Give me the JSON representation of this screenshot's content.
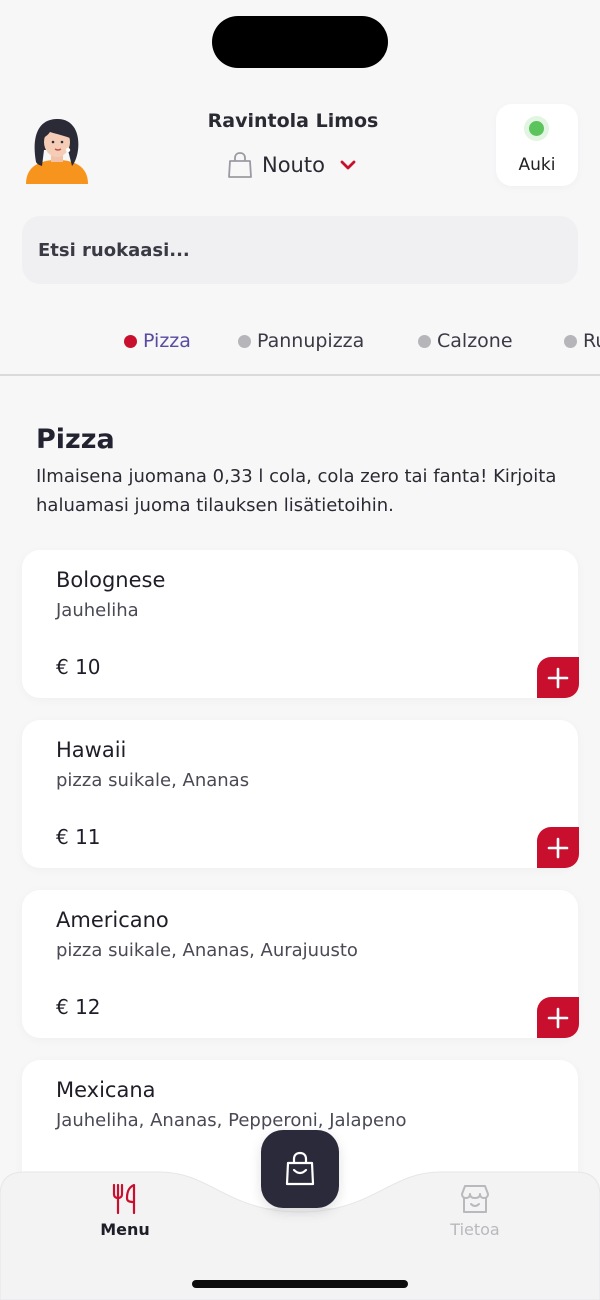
{
  "header": {
    "store_name": "Ravintola Limos",
    "mode_label": "Nouto",
    "status_label": "Auki"
  },
  "search": {
    "placeholder": "Etsi ruokaasi..."
  },
  "tabs": [
    {
      "label": "Pizza",
      "active": true
    },
    {
      "label": "Pannupizza",
      "active": false
    },
    {
      "label": "Calzone",
      "active": false
    },
    {
      "label": "Ru",
      "active": false
    }
  ],
  "section": {
    "title": "Pizza",
    "description": "Ilmaisena juomana 0,33 l cola, cola zero tai fanta! Kirjoita haluamasi juoma tilauksen lisätietoihin."
  },
  "items": [
    {
      "name": "Bolognese",
      "description": "Jauheliha",
      "price": "€ 10"
    },
    {
      "name": "Hawaii",
      "description": "pizza suikale, Ananas",
      "price": "€ 11"
    },
    {
      "name": "Americano",
      "description": "pizza suikale, Ananas, Aurajuusto",
      "price": "€ 12"
    },
    {
      "name": "Mexicana",
      "description": "Jauheliha, Ananas, Pepperoni, Jalapeno",
      "price": ""
    }
  ],
  "bottom_nav": {
    "menu_label": "Menu",
    "info_label": "Tietoa"
  },
  "colors": {
    "accent": "#c8102e",
    "open_status": "#5cc45c",
    "active_tab_text": "#5a4aa0",
    "cart_button": "#2a2a3a"
  },
  "icons": {
    "avatar": "avatar",
    "mode": "shopping-bag-icon",
    "dropdown": "chevron-down-icon",
    "add": "plus-icon",
    "menu": "fork-knife-icon",
    "info": "store-icon",
    "cart": "shopping-bag-icon"
  }
}
